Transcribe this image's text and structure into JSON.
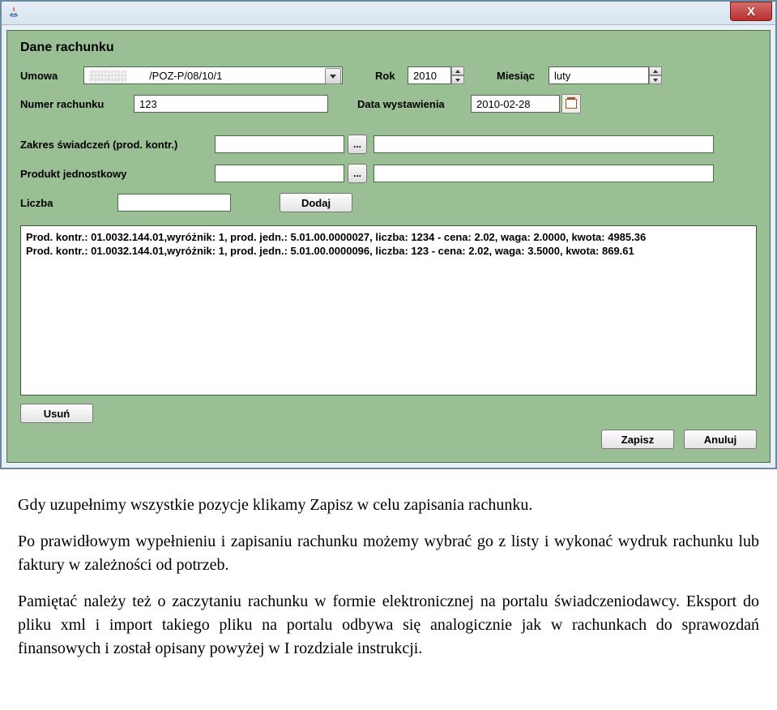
{
  "window": {
    "close_label": "X"
  },
  "panel": {
    "title": "Dane rachunku",
    "umowa_label": "Umowa",
    "umowa_value": "/POZ-P/08/10/1",
    "rok_label": "Rok",
    "rok_value": "2010",
    "miesiac_label": "Miesiąc",
    "miesiac_value": "luty",
    "numer_label": "Numer rachunku",
    "numer_value": "123",
    "data_label": "Data wystawienia",
    "data_value": "2010-02-28",
    "zakres_label": "Zakres świadczeń (prod. kontr.)",
    "produkt_label": "Produkt jednostkowy",
    "liczba_label": "Liczba",
    "dodaj_label": "Dodaj",
    "lookup_label": "...",
    "list_items": [
      "Prod. kontr.: 01.0032.144.01,wyróżnik: 1, prod. jedn.: 5.01.00.0000027, liczba: 1234  -  cena: 2.02, waga: 2.0000, kwota: 4985.36",
      "Prod. kontr.: 01.0032.144.01,wyróżnik: 1, prod. jedn.: 5.01.00.0000096, liczba: 123  -  cena: 2.02, waga: 3.5000, kwota: 869.61"
    ],
    "usun_label": "Usuń",
    "zapisz_label": "Zapisz",
    "anuluj_label": "Anuluj"
  },
  "doc": {
    "p1": "Gdy uzupełnimy wszystkie pozycje klikamy Zapisz w celu zapisania rachunku.",
    "p2": "Po prawidłowym wypełnieniu i zapisaniu rachunku możemy wybrać go z listy i wykonać wydruk rachunku lub faktury w zależności od potrzeb.",
    "p3": "Pamiętać należy też o zaczytaniu rachunku w formie elektronicznej na portalu świadczeniodawcy. Eksport do pliku xml i import takiego pliku na portalu odbywa się analogicznie jak w rachunkach do sprawozdań finansowych i został opisany powyżej w I rozdziale instrukcji."
  }
}
